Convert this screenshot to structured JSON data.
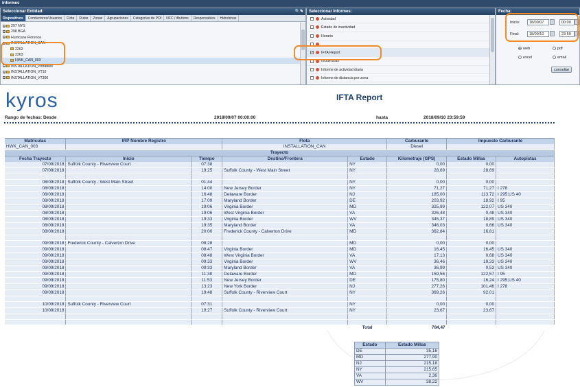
{
  "app": {
    "title": "Informes"
  },
  "entities_panel": {
    "header": "Seleccionar Entidad:",
    "tabs": [
      "Dispositivos",
      "Conductores/Usuarios",
      "Flota",
      "Rutas",
      "Zonas",
      "Agrupaciones",
      "Categorías de POI",
      "NFC / iButtons",
      "Responsables",
      "Hidrobinas"
    ],
    "tree": [
      {
        "label": "297 NYS"
      },
      {
        "label": "298 BGA"
      },
      {
        "label": "Hurricane Florence"
      },
      {
        "label": "INSTALLATION_CAN"
      },
      {
        "label": "2262"
      },
      {
        "label": "2263"
      },
      {
        "label": "HWK_CAN_003"
      },
      {
        "label": "INSTALLATION_Portables"
      },
      {
        "label": "INSTALLATION_VT10"
      },
      {
        "label": "INSTALLATION_VT300"
      }
    ]
  },
  "reports_panel": {
    "header": "Seleccionar Informes:",
    "items": [
      {
        "label": "Actividad",
        "checked": false
      },
      {
        "label": "Estado de inactividad",
        "checked": false
      },
      {
        "label": "Horario",
        "checked": false
      },
      {
        "label": "",
        "checked": false
      },
      {
        "label": "IFTA Report",
        "checked": true
      },
      {
        "label": "Incidencias",
        "checked": false
      },
      {
        "label": "Informe de actividad diaria",
        "checked": false
      },
      {
        "label": "Informe de distancia por zona",
        "checked": false
      }
    ]
  },
  "date_panel": {
    "header": "Fecha:",
    "start_label": "Inicio:",
    "start_date": "18/09/07",
    "start_time": "00:00",
    "end_label": "Final:",
    "end_date": "18/09/10",
    "end_time": "23:59",
    "formats": [
      {
        "label": "web",
        "selected": true
      },
      {
        "label": "pdf",
        "selected": false
      },
      {
        "label": "excel",
        "selected": false
      },
      {
        "label": "email",
        "selected": false
      }
    ],
    "consult_button": "consultar"
  },
  "report": {
    "logo": "kyros",
    "title": "IFTA Report",
    "range_label": "Rango de fechas: Desde",
    "range_from": "2018/09/07 00:00:00",
    "range_to_label": "hasta",
    "range_to": "2018/09/10 23:59:59",
    "header_row": [
      "Matrículas",
      "IRP Nombre Registro",
      "Flota",
      "Carburante",
      "Impuesto Carburante"
    ],
    "header_values": [
      "HWK_CAN_003",
      "",
      "INSTALLATION_CAN",
      "Diesel",
      ""
    ],
    "section": "Trayecto",
    "columns": [
      "Fecha Trayecto",
      "Inicio",
      "Tiempo",
      "Destino/Frontera",
      "Estado",
      "Kilometraje (GPS)",
      "Estado Millas",
      "Autopistas"
    ],
    "rows": [
      [
        "07/09/2018",
        "Suffolk County - Riverview Court",
        "07:38",
        "",
        "NY",
        "0,00",
        "0,00",
        ""
      ],
      [
        "07/09/2018",
        "",
        "19:25",
        "Suffolk County - West Main Street",
        "NY",
        "28,69",
        "28,69",
        ""
      ],
      [
        "",
        "",
        "",
        "",
        "",
        "",
        "",
        ""
      ],
      [
        "08/09/2018",
        "Suffolk County - West Main Street",
        "01:44",
        "",
        "NY",
        "0,00",
        "0,00",
        ""
      ],
      [
        "08/09/2018",
        "",
        "14:00",
        "New Jersey Border",
        "NY",
        "71,27",
        "71,27",
        "I 278"
      ],
      [
        "08/09/2018",
        "",
        "16:48",
        "Delaware Border",
        "NJ",
        "185,00",
        "113,72",
        "I 295;US 40"
      ],
      [
        "08/09/2018",
        "",
        "17:09",
        "Maryland Border",
        "DE",
        "203,92",
        "18,92",
        "I 95"
      ],
      [
        "08/09/2018",
        "",
        "19:06",
        "Virginia Border",
        "MD",
        "325,99",
        "122,07",
        "US 340"
      ],
      [
        "08/09/2018",
        "",
        "19:06",
        "West Virginia Border",
        "VA",
        "326,48",
        "0,48",
        "US 340"
      ],
      [
        "08/09/2018",
        "",
        "19:33",
        "Virginia Border",
        "WV",
        "345,37",
        "18,89",
        "US 340"
      ],
      [
        "08/09/2018",
        "",
        "19:35",
        "Maryland Border",
        "VA",
        "346,03",
        "0,66",
        "US 340"
      ],
      [
        "08/09/2018",
        "",
        "20:00",
        "Frederick County - Calverton Drive",
        "MD",
        "362,84",
        "16,81",
        ""
      ],
      [
        "",
        "",
        "",
        "",
        "",
        "",
        "",
        ""
      ],
      [
        "09/09/2018",
        "Frederick County - Calverton Drive",
        "08:28",
        "",
        "MD",
        "0,00",
        "0,00",
        ""
      ],
      [
        "09/09/2018",
        "",
        "08:47",
        "Virginia Border",
        "MD",
        "16,45",
        "16,45",
        "US 340"
      ],
      [
        "09/09/2018",
        "",
        "08:48",
        "West Virginia Border",
        "VA",
        "17,13",
        "0,68",
        "US 340"
      ],
      [
        "09/09/2018",
        "",
        "09:33",
        "Virginia Border",
        "WV",
        "36,46",
        "19,33",
        "US 340"
      ],
      [
        "09/09/2018",
        "",
        "09:33",
        "Maryland Border",
        "VA",
        "36,99",
        "0,53",
        "US 340"
      ],
      [
        "09/09/2018",
        "",
        "11:38",
        "Delaware Border",
        "MD",
        "159,56",
        "122,57",
        "I 95"
      ],
      [
        "09/09/2018",
        "",
        "11:53",
        "New Jersey Border",
        "DE",
        "175,80",
        "16,24",
        "I 295;US 40"
      ],
      [
        "09/09/2018",
        "",
        "13:23",
        "New York Border",
        "NJ",
        "277,26",
        "101,46",
        "I 278"
      ],
      [
        "09/09/2018",
        "",
        "19:48",
        "Suffolk County - Riverview Court",
        "NY",
        "369,26",
        "92,01",
        ""
      ],
      [
        "",
        "",
        "",
        "",
        "",
        "",
        "",
        ""
      ],
      [
        "10/09/2018",
        "Suffolk County - Riverview Court",
        "07:31",
        "",
        "NY",
        "0,00",
        "0,00",
        ""
      ],
      [
        "10/09/2018",
        "",
        "19:27",
        "Suffolk County - Riverview Court",
        "NY",
        "23,67",
        "23,67",
        ""
      ],
      [
        "",
        "",
        "",
        "",
        "",
        "",
        "",
        ""
      ],
      [
        "",
        "",
        "",
        "",
        "",
        "",
        "",
        ""
      ]
    ],
    "total_label": "Total",
    "total_value": "784,47",
    "summary_columns": [
      "Estado",
      "Estado Millas"
    ],
    "summary": [
      [
        "DE",
        "35,16"
      ],
      [
        "MD",
        "277,90"
      ],
      [
        "NJ",
        "215,18"
      ],
      [
        "NY",
        "215,65"
      ],
      [
        "VA",
        "2,36"
      ],
      [
        "WV",
        "38,22"
      ]
    ]
  },
  "colors": {
    "highlight": "#f08a2a",
    "header_bg": "#c3d3ea",
    "row_bg": "#e6edf6",
    "title": "#1d3f6e",
    "logo": "#2d5fa3"
  }
}
